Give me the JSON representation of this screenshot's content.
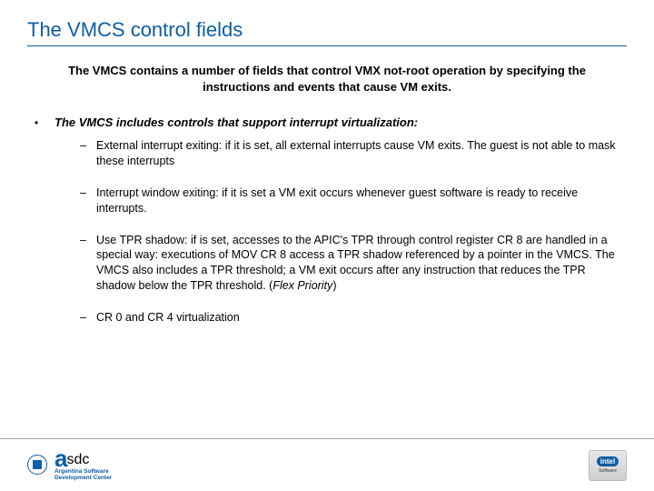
{
  "title": "The VMCS control fields",
  "subtitle": "The VMCS contains a number of fields that control VMX not-root operation by specifying the instructions and events that cause VM exits.",
  "bullet": {
    "marker": "•",
    "text": "The VMCS includes controls that support interrupt virtualization:"
  },
  "subitems": [
    "External interrupt exiting: if it is set, all external interrupts cause VM exits. The guest is not able to mask these interrupts",
    "Interrupt window exiting: if it is set a VM exit occurs whenever guest software is ready to receive interrupts.",
    "Use TPR shadow: if is set, accesses to the APIC's TPR through control register CR 8 are handled in a special way: executions of MOV CR 8 access a TPR shadow referenced by a pointer in the VMCS. The VMCS also includes a TPR threshold; a VM exit occurs after any instruction that reduces the TPR shadow below the TPR threshold. (",
    "CR 0 and CR 4 virtualization"
  ],
  "flex_priority": "Flex Priority",
  "close_paren": ")",
  "dash": "–",
  "footer": {
    "asdc_line1": "Argentina Software",
    "asdc_line2": "Development Center",
    "intel": "intel",
    "intel_sub": "Software"
  }
}
